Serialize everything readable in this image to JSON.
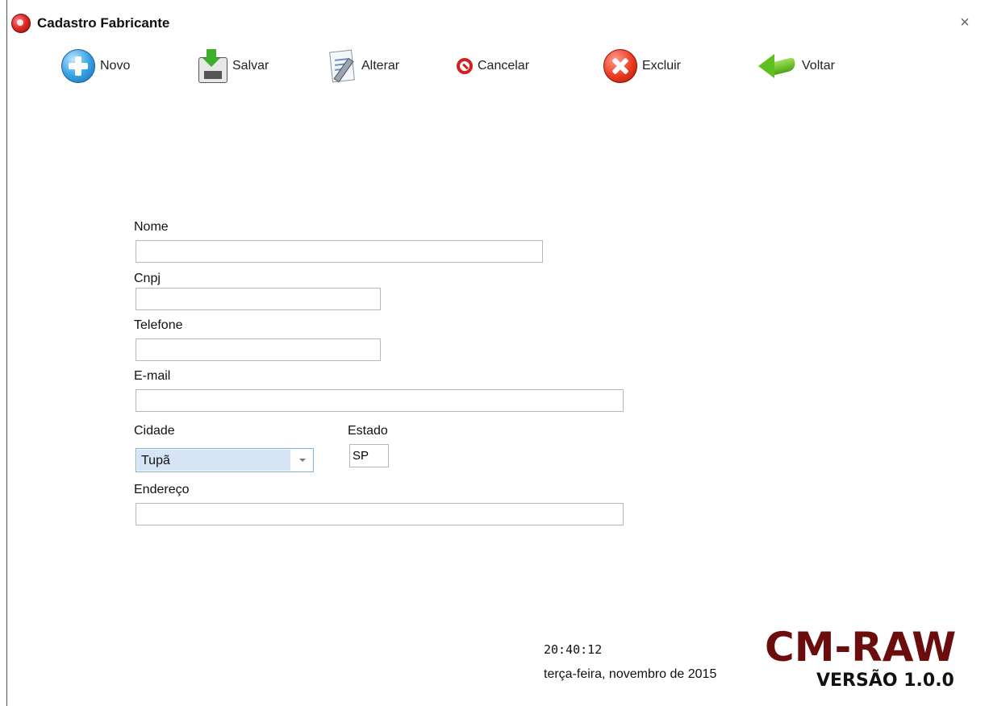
{
  "window": {
    "title": "Cadastro Fabricante",
    "close_symbol": "×"
  },
  "toolbar": {
    "novo": "Novo",
    "salvar": "Salvar",
    "alterar": "Alterar",
    "cancelar": "Cancelar",
    "excluir": "Excluir",
    "voltar": "Voltar"
  },
  "form": {
    "nome": {
      "label": "Nome",
      "value": ""
    },
    "cnpj": {
      "label": "Cnpj",
      "value": ""
    },
    "telefone": {
      "label": "Telefone",
      "value": ""
    },
    "email": {
      "label": "E-mail",
      "value": ""
    },
    "cidade": {
      "label": "Cidade",
      "value": "Tupã"
    },
    "estado": {
      "label": "Estado",
      "value": "SP"
    },
    "endereco": {
      "label": "Endereço",
      "value": ""
    }
  },
  "status": {
    "time": "20:40:12",
    "date": "terça-feira, novembro de 2015"
  },
  "brand": {
    "name": "CM-RAW",
    "version": "VERSÃO 1.0.0"
  },
  "colors": {
    "brand": "#6b0d0d",
    "combo_highlight": "#d6e4f5"
  }
}
